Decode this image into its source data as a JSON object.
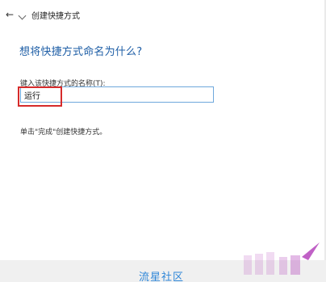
{
  "window": {
    "title": "创建快捷方式",
    "back_glyph": "←",
    "back_icon": "arrow-left-icon",
    "shortcut_icon": "shortcut-arrow-icon"
  },
  "main": {
    "heading": "想将快捷方式命名为什么?",
    "field_label": "键入该快捷方式的名称(T):",
    "field_value": "运行",
    "hint": "单击\"完成\"创建快捷方式。"
  },
  "footer": {
    "text": "流星社区"
  },
  "colors": {
    "accent": "#1e5ea6",
    "footer_text": "#2e86d8",
    "highlight": "#d62b2b",
    "input_border": "#6fa8dc",
    "watermark": "#b03ab8"
  }
}
